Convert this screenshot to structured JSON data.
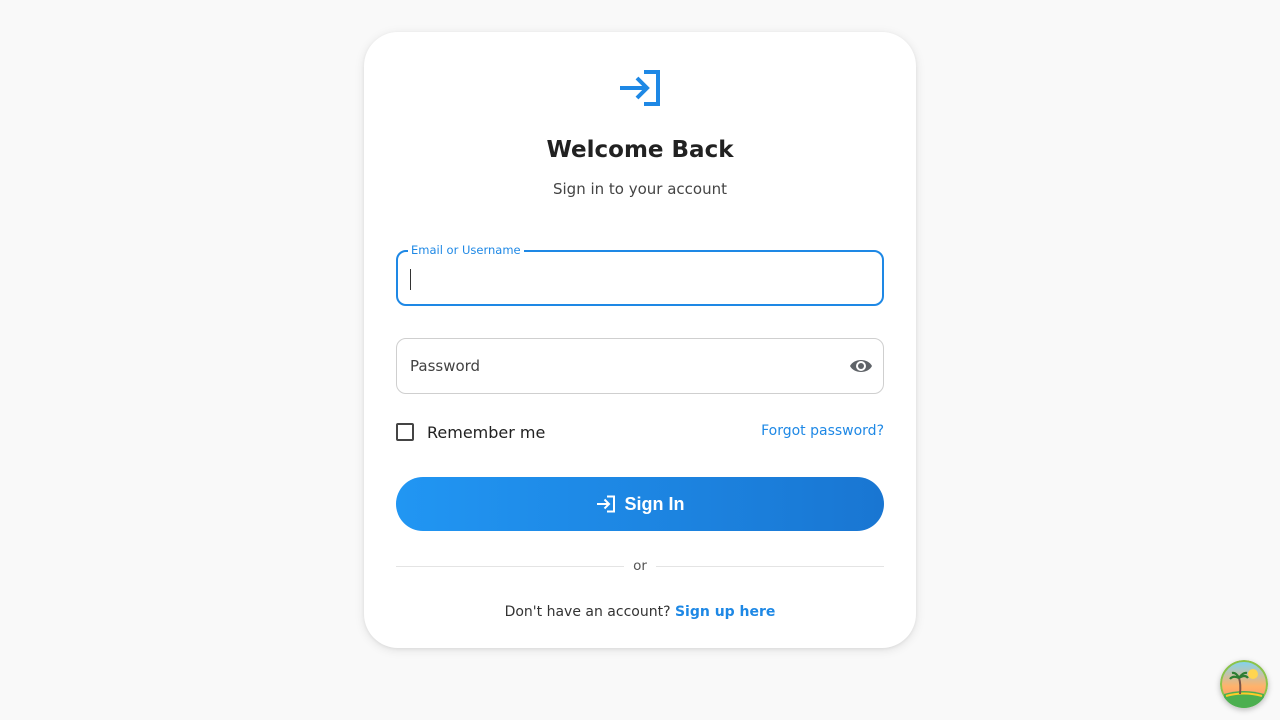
{
  "header": {
    "title": "Welcome Back",
    "subtitle": "Sign in to your account"
  },
  "form": {
    "email": {
      "label": "Email or Username",
      "value": ""
    },
    "password": {
      "placeholder": "Password",
      "value": ""
    },
    "remember_label": "Remember me",
    "remember_checked": false,
    "forgot_label": "Forgot password?",
    "submit_label": "Sign In"
  },
  "divider_label": "or",
  "footer": {
    "prompt": "Don't have an account?",
    "signup_label": "Sign up here"
  },
  "colors": {
    "accent": "#1e88e5",
    "button_gradient_start": "#2196f3",
    "button_gradient_end": "#1976d2"
  },
  "icons": {
    "logo": "login-icon",
    "password_toggle": "eye-icon",
    "submit": "login-icon",
    "corner_badge": "beach-island-icon"
  }
}
